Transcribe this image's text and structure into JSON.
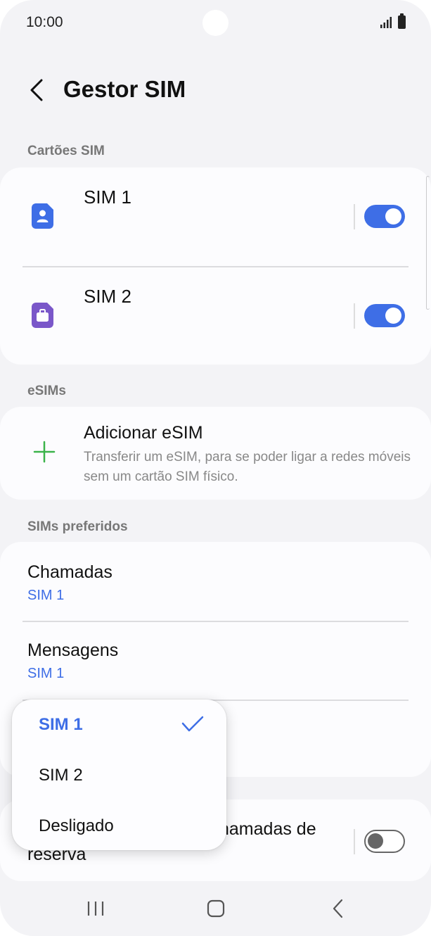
{
  "status_bar": {
    "time": "10:00"
  },
  "header": {
    "title": "Gestor SIM"
  },
  "sections": {
    "sim_cards": "Cartões SIM",
    "esims": "eSIMs",
    "preferred": "SIMs preferidos"
  },
  "sim_cards": [
    {
      "label": "SIM 1",
      "enabled": true,
      "icon": "person-sim-icon",
      "color": "#3e6ee6"
    },
    {
      "label": "SIM 2",
      "enabled": true,
      "icon": "briefcase-sim-icon",
      "color": "#7a57c9"
    }
  ],
  "esim": {
    "title": "Adicionar eSIM",
    "description": "Transferir um eSIM, para se poder ligar a redes móveis sem um cartão SIM físico."
  },
  "preferred": {
    "calls_title": "Chamadas",
    "calls_value": "SIM 1",
    "messages_title": "Mensagens",
    "messages_value": "SIM 1"
  },
  "backup_calls": {
    "partial_line1": "hamadas de",
    "line2": "reserva",
    "enabled": false
  },
  "popup": {
    "options": [
      {
        "label": "SIM 1",
        "selected": true
      },
      {
        "label": "SIM 2",
        "selected": false
      },
      {
        "label": "Desligado",
        "selected": false
      }
    ]
  },
  "nav": {
    "recents": "recents-icon",
    "home": "home-icon",
    "back": "back-icon"
  },
  "colors": {
    "accent": "#3e6ee6",
    "background": "#f3f3f6",
    "card": "#fcfcfe",
    "add_icon": "#3bb34a"
  }
}
